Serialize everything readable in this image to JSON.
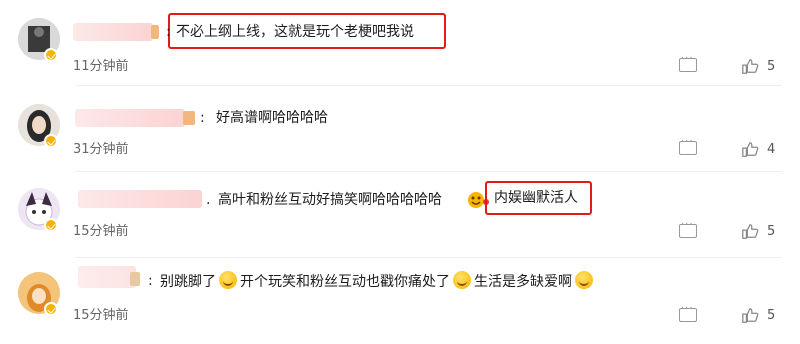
{
  "comments": [
    {
      "separator": ":",
      "text": "不必上纲上线，这就是玩个老梗吧我说",
      "time": "11分钟前",
      "likes": "5"
    },
    {
      "separator": ":",
      "text": "好高谱啊哈哈哈哈",
      "time": "31分钟前",
      "likes": "4"
    },
    {
      "separator": ".",
      "text": "高叶和粉丝互动好搞笑啊哈哈哈哈哈",
      "highlight_text": "内娱幽默活人",
      "time": "15分钟前",
      "likes": "5"
    },
    {
      "separator": ":",
      "text_part1": "别跳脚了",
      "text_part2": "开个玩笑和粉丝互动也戳你痛处了",
      "text_part3": "生活是多缺爱啊",
      "time": "15分钟前",
      "likes": "5"
    }
  ],
  "icons": {
    "reply": "comment-icon",
    "like": "thumbs-up-icon",
    "verified": "verified-badge-icon"
  },
  "colors": {
    "highlight_border": "#e21a1a",
    "verified": "#f6b400"
  }
}
